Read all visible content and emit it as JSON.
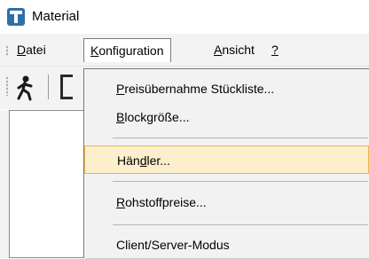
{
  "window": {
    "title": "Material",
    "icon": "app-icon"
  },
  "menubar": {
    "items": [
      {
        "pre": "",
        "u": "D",
        "post": "atei"
      },
      {
        "pre": "",
        "u": "K",
        "post": "onfiguration"
      },
      {
        "pre": "",
        "u": "A",
        "post": "nsicht"
      },
      {
        "pre": "",
        "u": "?",
        "post": ""
      }
    ]
  },
  "toolbar": {
    "buttons": [
      "run-icon"
    ]
  },
  "konfiguration_menu": {
    "items": [
      {
        "pre": "",
        "u": "P",
        "post": "reisübernahme Stückliste..."
      },
      {
        "pre": "",
        "u": "B",
        "post": "lockgröße..."
      },
      {
        "pre": "Hän",
        "u": "d",
        "post": "ler..."
      },
      {
        "pre": "",
        "u": "R",
        "post": "ohstoffpreise..."
      },
      {
        "pre": "Client/Server-Modus",
        "u": "",
        "post": ""
      }
    ],
    "highlighted": "Händler..."
  },
  "colors": {
    "highlight_bg": "#fcefcd",
    "highlight_border": "#e8b64a",
    "icon_blue": "#2f6fa8"
  }
}
